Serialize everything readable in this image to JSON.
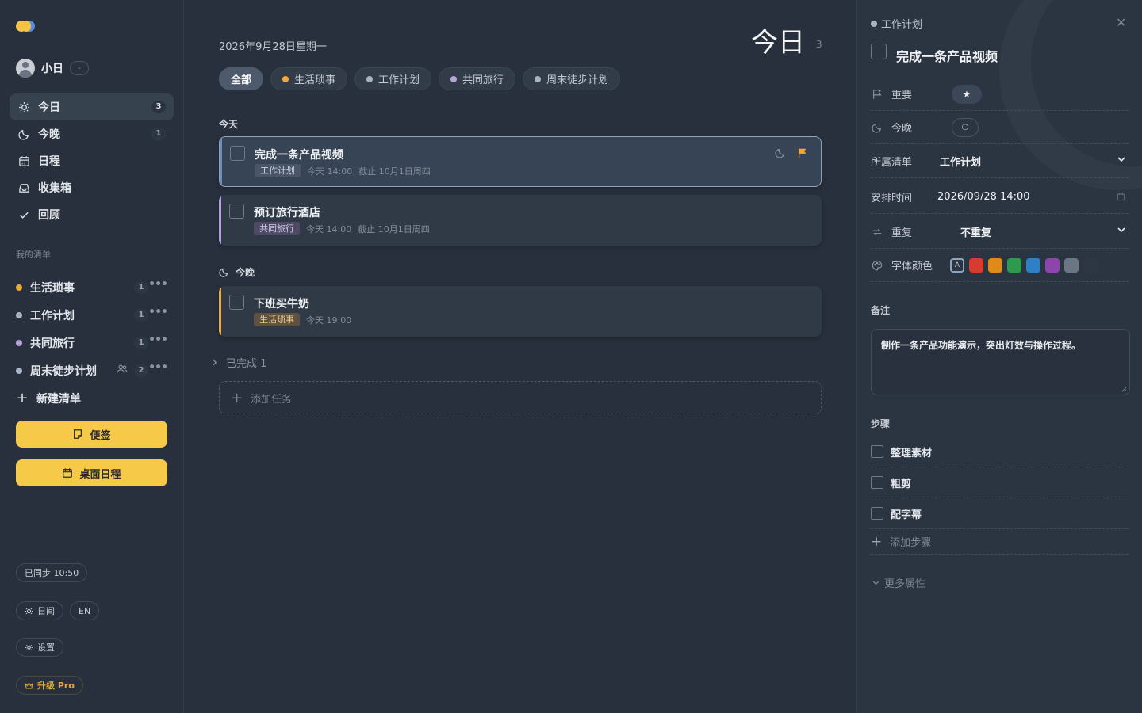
{
  "user": {
    "name": "小日",
    "menu": "-"
  },
  "nav": [
    {
      "label": "今日",
      "count": "3",
      "icon": "sun-icon"
    },
    {
      "label": "今晚",
      "count": "1",
      "icon": "moon-icon"
    },
    {
      "label": "日程",
      "count": "",
      "icon": "calendar-icon"
    },
    {
      "label": "收集箱",
      "count": "",
      "icon": "inbox-icon"
    },
    {
      "label": "回顾",
      "count": "",
      "icon": "check-icon"
    }
  ],
  "lists_section": "我的清单",
  "lists": [
    {
      "name": "生活琐事",
      "count": "1",
      "color": "#f0a83a"
    },
    {
      "name": "工作计划",
      "count": "1",
      "color": "#a8b4c4"
    },
    {
      "name": "共同旅行",
      "count": "1",
      "color": "#b8a4d8"
    },
    {
      "name": "周末徒步计划",
      "count": "2",
      "color": "#a8b4c4",
      "shared": true
    }
  ],
  "new_list": "新建清单",
  "buttons": {
    "sticky": "便签",
    "desktop": "桌面日程"
  },
  "footer": {
    "sync": "已同步 10:50",
    "theme": "日间",
    "lang": "EN",
    "settings": "设置",
    "pro": "升级 Pro"
  },
  "main": {
    "date": "2026年9月28日星期一",
    "title": "今日",
    "count": "3",
    "filters": [
      {
        "label": "全部",
        "active": true,
        "color": ""
      },
      {
        "label": "生活琐事",
        "color": "#f0a83a"
      },
      {
        "label": "工作计划",
        "color": "#a8b4c4"
      },
      {
        "label": "共同旅行",
        "color": "#b8a4d8"
      },
      {
        "label": "周末徒步计划",
        "color": "#a8b4c4"
      }
    ],
    "group_today": "今天",
    "group_tonight": "今晚",
    "tasks": [
      {
        "title": "完成一条产品视频",
        "tag": "工作计划",
        "time": "今天 14:00",
        "due": "截止 10月1日周四"
      },
      {
        "title": "预订旅行酒店",
        "tag": "共同旅行",
        "time": "今天 14:00",
        "due": "截止 10月1日周四"
      },
      {
        "title": "下班买牛奶",
        "tag": "生活琐事",
        "time": "今天 19:00",
        "due": ""
      }
    ],
    "completed": "已完成 1",
    "add_task": "添加任务"
  },
  "colors": {
    "accent_work": "#6e8fb8",
    "accent_travel": "#b39ddb",
    "accent_life": "#f0a83a",
    "flag": "#f0a83a"
  },
  "detail": {
    "list": "工作计划",
    "title": "完成一条产品视频",
    "important_label": "重要",
    "tonight_label": "今晚",
    "list_label": "所属清单",
    "list_value": "工作计划",
    "schedule_label": "安排时间",
    "schedule_value": "2026/09/28 14:00",
    "repeat_label": "重复",
    "repeat_value": "不重复",
    "color_label": "字体颜色",
    "swatch_a": "A",
    "swatches": [
      "#d63c2f",
      "#e08a1a",
      "#2e9a4f",
      "#2f7fc4",
      "#8e44ad",
      "#6b7685",
      "#2d3642"
    ],
    "notes_label": "备注",
    "notes": "制作一条产品功能演示，突出灯效与操作过程。",
    "steps_label": "步骤",
    "steps": [
      "整理素材",
      "粗剪",
      "配字幕"
    ],
    "add_step": "添加步骤",
    "more": "更多属性"
  }
}
